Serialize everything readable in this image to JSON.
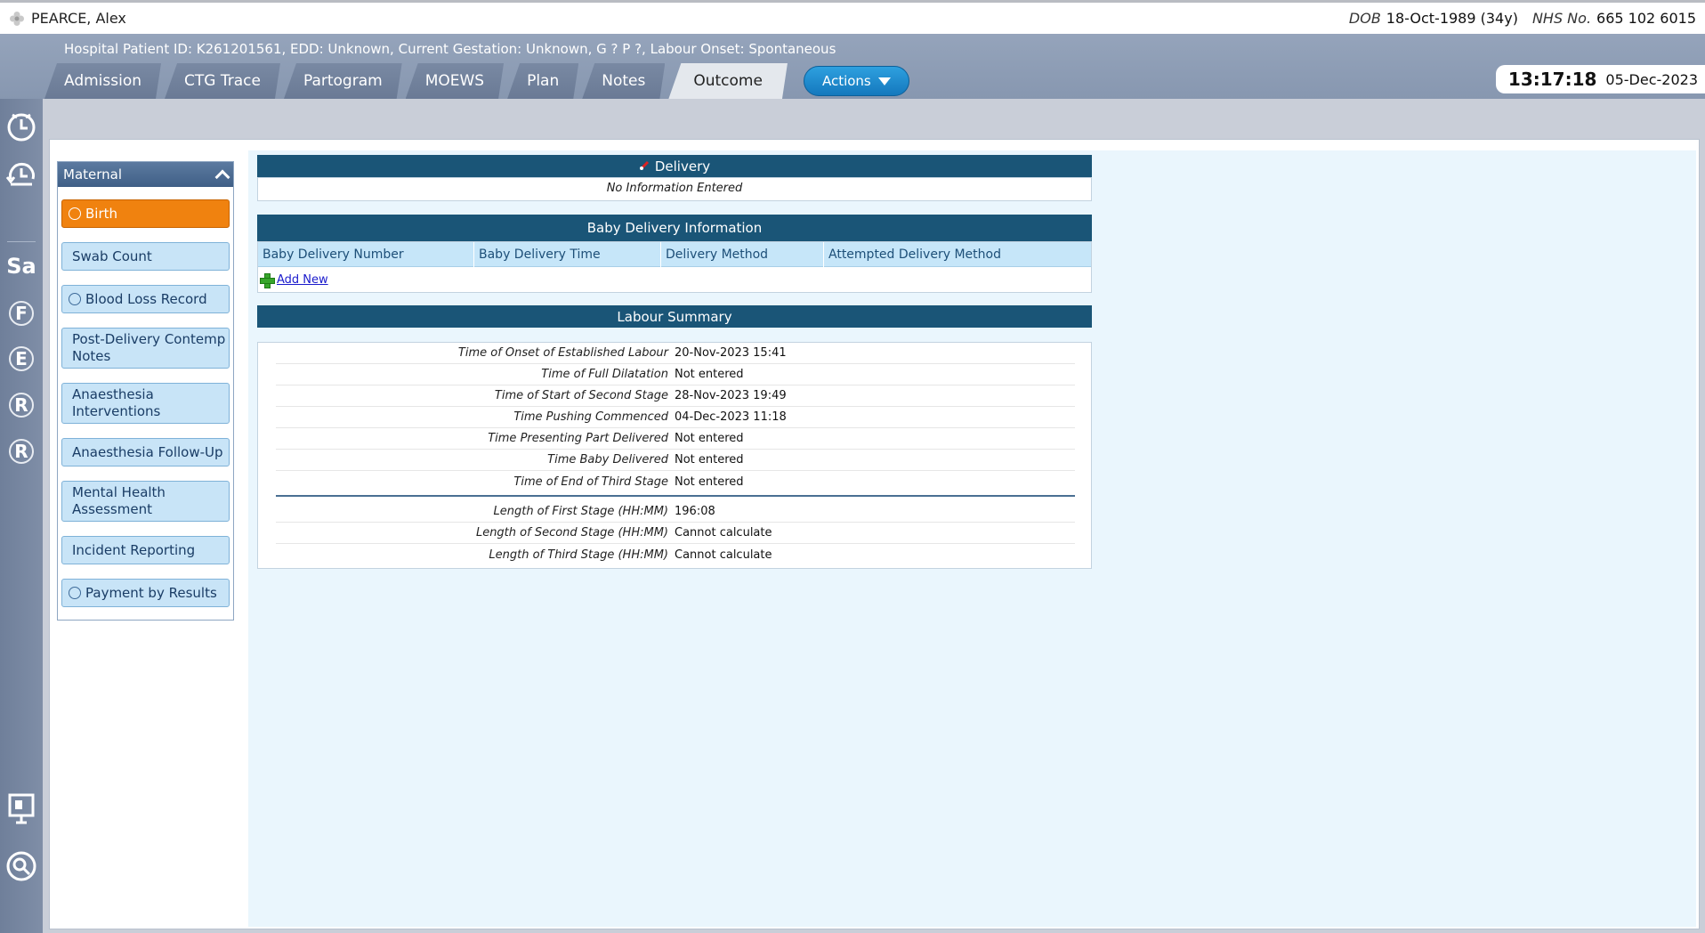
{
  "patient": {
    "name": "PEARCE, Alex",
    "dob_label": "DOB",
    "dob_value": "18-Oct-1989 (34y)",
    "nhs_label": "NHS No.",
    "nhs_value": "665 102 6015"
  },
  "header": {
    "info_line": "Hospital Patient ID: K261201561,   EDD: Unknown,   Current Gestation: Unknown, G ? P ?,   Labour Onset: Spontaneous",
    "tabs": [
      {
        "label": "Admission"
      },
      {
        "label": "CTG Trace"
      },
      {
        "label": "Partogram"
      },
      {
        "label": "MOEWS"
      },
      {
        "label": "Plan"
      },
      {
        "label": "Notes"
      },
      {
        "label": "Outcome",
        "active": true
      }
    ],
    "actions_label": "Actions",
    "clock_time": "13:17:18",
    "clock_date": "05-Dec-2023"
  },
  "rail": {
    "items": [
      {
        "icon": "clock-icon"
      },
      {
        "icon": "history-clock-icon"
      },
      {
        "text": "Sa"
      },
      {
        "text": "F"
      },
      {
        "text": "E"
      },
      {
        "text": "R"
      },
      {
        "text": "R"
      },
      {
        "icon": "presentation-icon"
      },
      {
        "icon": "search-icon"
      }
    ]
  },
  "sidebar": {
    "header": "Maternal",
    "items": [
      {
        "label": "Birth",
        "radio": true,
        "active": true
      },
      {
        "label": "Swab Count",
        "radio": false
      },
      {
        "label": "Blood Loss Record",
        "radio": true
      },
      {
        "label": "Post-Delivery Contemp Notes",
        "radio": false
      },
      {
        "label": "Anaesthesia Interventions",
        "radio": false
      },
      {
        "label": "Anaesthesia Follow-Up",
        "radio": false
      },
      {
        "label": "Mental Health Assessment",
        "radio": false
      },
      {
        "label": "Incident Reporting",
        "radio": false
      },
      {
        "label": "Payment by Results",
        "radio": true
      }
    ]
  },
  "delivery": {
    "title": "Delivery",
    "empty_text": "No Information Entered"
  },
  "baby_delivery": {
    "title": "Baby Delivery Information",
    "columns": [
      "Baby Delivery Number",
      "Baby Delivery Time",
      "Delivery Method",
      "Attempted Delivery Method"
    ],
    "add_new": "Add New"
  },
  "labour_summary": {
    "title": "Labour Summary",
    "times": [
      {
        "label": "Time of Onset of Established Labour",
        "value": "20-Nov-2023 15:41"
      },
      {
        "label": "Time of Full Dilatation",
        "value": "Not entered"
      },
      {
        "label": "Time of Start of Second Stage",
        "value": "28-Nov-2023 19:49"
      },
      {
        "label": "Time Pushing Commenced",
        "value": "04-Dec-2023 11:18"
      },
      {
        "label": "Time Presenting Part Delivered",
        "value": "Not entered"
      },
      {
        "label": "Time Baby Delivered",
        "value": "Not entered"
      },
      {
        "label": "Time of End of Third Stage",
        "value": "Not entered"
      }
    ],
    "lengths": [
      {
        "label": "Length of First Stage (HH:MM)",
        "value": "196:08"
      },
      {
        "label": "Length of Second Stage (HH:MM)",
        "value": "Cannot calculate"
      },
      {
        "label": "Length of Third Stage (HH:MM)",
        "value": "Cannot calculate"
      }
    ]
  }
}
